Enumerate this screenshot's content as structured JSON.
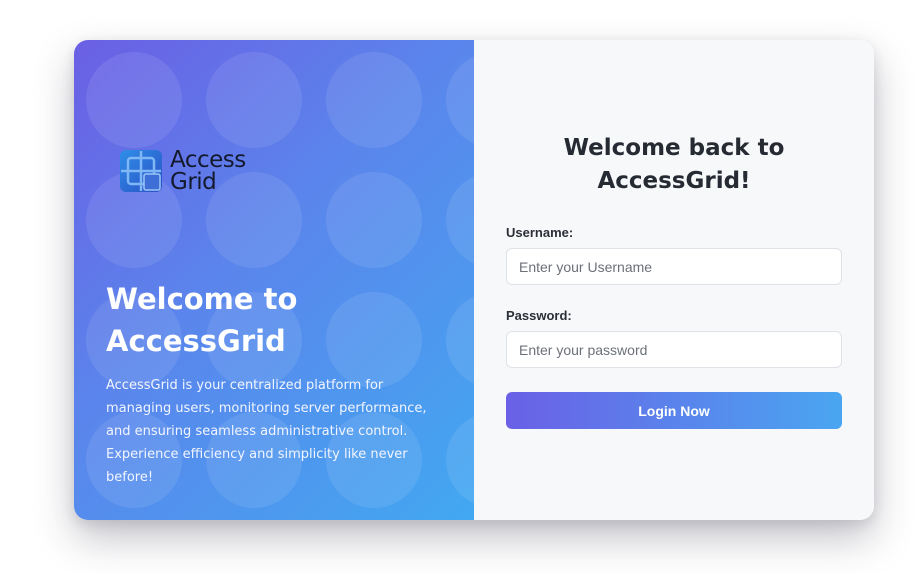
{
  "brand": {
    "logo_line1": "Access",
    "logo_line2": "Grid",
    "icon": "grid-logo-icon"
  },
  "hero": {
    "title": "Welcome to AccessGrid",
    "description": "AccessGrid is your centralized platform for managing users, monitoring server performance, and ensuring seamless administrative control. Experience efficiency and simplicity like never before!"
  },
  "form": {
    "title": "Welcome back to AccessGrid!",
    "username_label": "Username:",
    "username_placeholder": "Enter your Username",
    "username_value": "",
    "password_label": "Password:",
    "password_placeholder": "Enter your password",
    "password_value": "",
    "submit_label": "Login Now"
  },
  "colors": {
    "gradient_start": "#6b5fe4",
    "gradient_end": "#42a8f1",
    "form_bg": "#f7f8fa",
    "title_text": "#252a33"
  }
}
